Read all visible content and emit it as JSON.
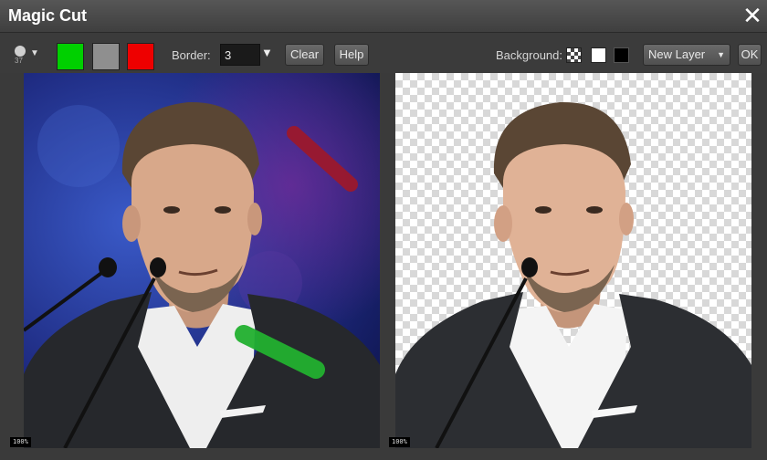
{
  "window": {
    "title": "Magic Cut",
    "close_glyph": "✕"
  },
  "toolbar": {
    "brush": {
      "size": "37",
      "caret": "▼"
    },
    "swatches": [
      {
        "name": "keep",
        "color": "#00d000"
      },
      {
        "name": "neutral",
        "color": "#8f8f8f"
      },
      {
        "name": "remove",
        "color": "#ee0000"
      }
    ],
    "border_label": "Border:",
    "border_value": "3",
    "border_caret": "▼",
    "clear_label": "Clear",
    "help_label": "Help",
    "background_label": "Background:",
    "background_options": [
      "transparent",
      "white",
      "black"
    ],
    "layer_select": "New Layer",
    "layer_caret": "▼",
    "ok_label": "OK"
  },
  "panels": {
    "left": {
      "zoom": "100%",
      "stroke_colors": {
        "keep": "#22b030",
        "remove": "#a01828"
      }
    },
    "right": {
      "zoom": "100%"
    }
  }
}
